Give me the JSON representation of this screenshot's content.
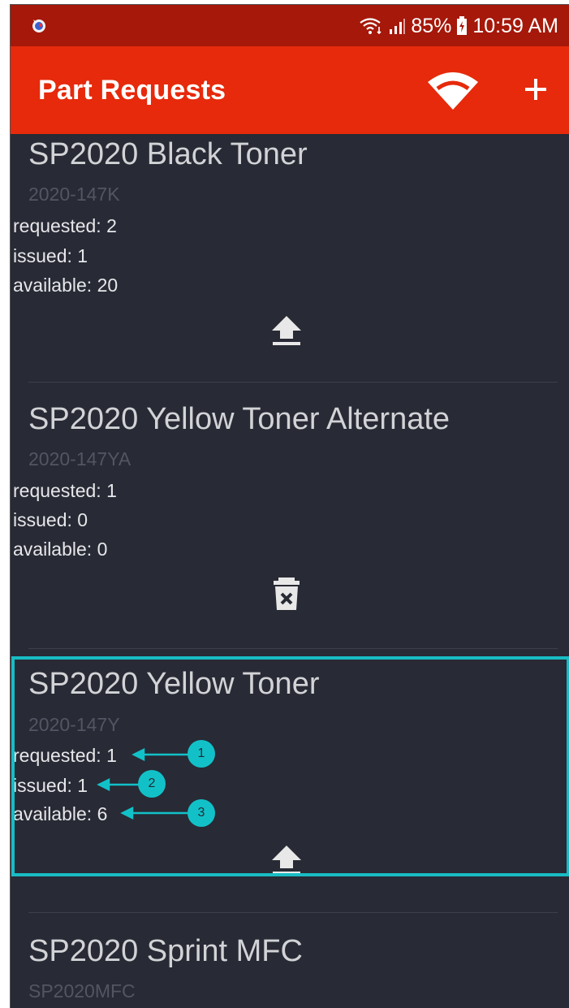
{
  "status_bar": {
    "battery": "85%",
    "time": "10:59 AM",
    "icons": [
      "app-notification-icon",
      "wifi-signal-icon",
      "cell-signal-icon",
      "battery-icon"
    ]
  },
  "app_bar": {
    "title": "Part Requests",
    "actions": [
      "wifi-icon",
      "add-icon"
    ]
  },
  "parts": [
    {
      "name": "SP2020 Black Toner",
      "number": "2020-147K",
      "requested": "requested: 2",
      "issued": "issued: 1",
      "available": "available: 20",
      "action": "upload-icon"
    },
    {
      "name": "SP2020 Yellow Toner Alternate",
      "number": "2020-147YA",
      "requested": "requested: 1",
      "issued": "issued: 0",
      "available": "available: 0",
      "action": "delete-icon"
    },
    {
      "name": "SP2020 Yellow Toner",
      "number": "2020-147Y",
      "requested": "requested: 1",
      "issued": "issued: 1",
      "available": "available: 6",
      "action": "upload-icon"
    },
    {
      "name": "SP2020 Sprint MFC",
      "number": "SP2020MFC"
    }
  ],
  "callouts": [
    "1",
    "2",
    "3"
  ],
  "colors": {
    "status_bar": "#a5180a",
    "app_bar": "#e62a0b",
    "background": "#282a35",
    "highlight": "#19bcc4"
  }
}
